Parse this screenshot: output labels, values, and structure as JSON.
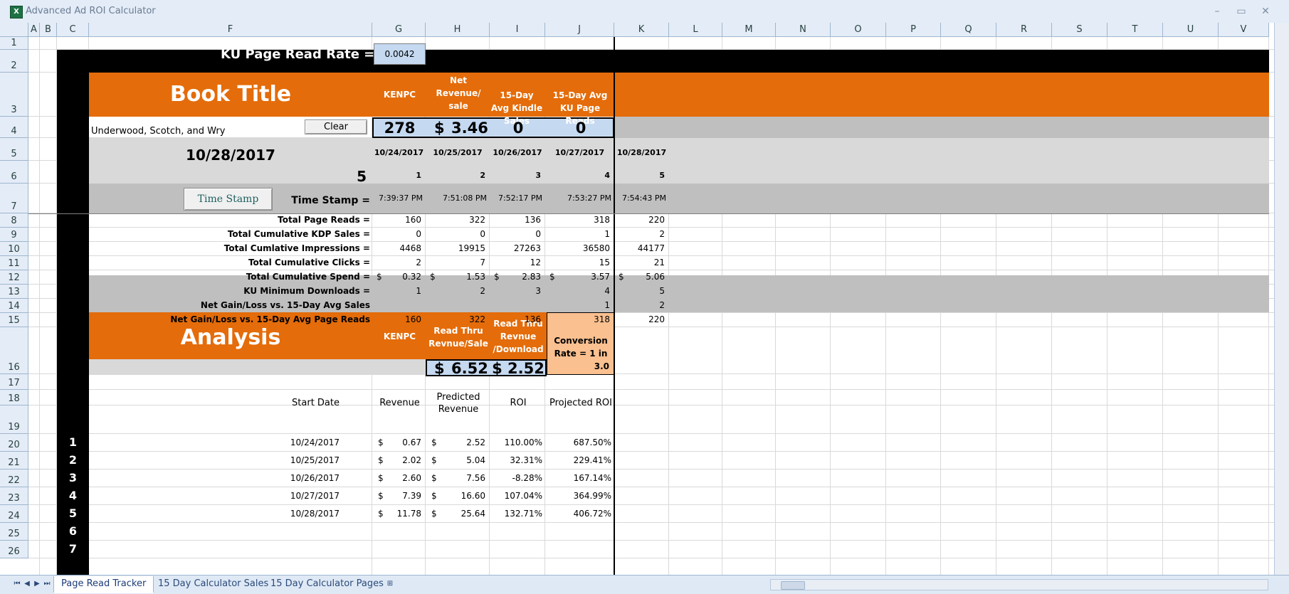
{
  "window": {
    "title": "Advanced Ad ROI Calculator",
    "icon": "excel-icon",
    "minimize": "–",
    "restore": "▭",
    "close": "✕"
  },
  "columns": [
    "A",
    "B",
    "C",
    "F",
    "G",
    "H",
    "I",
    "J",
    "K",
    "L",
    "M",
    "N",
    "O",
    "P",
    "Q",
    "R",
    "S",
    "T",
    "U",
    "V"
  ],
  "rows": [
    "1",
    "2",
    "3",
    "4",
    "5",
    "6",
    "7",
    "8",
    "9",
    "10",
    "11",
    "12",
    "13",
    "14",
    "15",
    "16",
    "17",
    "18",
    "19",
    "20",
    "21",
    "22",
    "23",
    "24",
    "25",
    "26"
  ],
  "ku_rate": {
    "label": "KU Page Read Rate =",
    "value": "0.0042"
  },
  "book_header": {
    "title": "Book Title",
    "kenpc": "KENPC",
    "net_rev": "Net Revenue/ sale",
    "avg_sales": "15-Day Avg Kindle Sales",
    "avg_reads": "15-Day Avg KU Page Reads"
  },
  "book": {
    "name": "Underwood, Scotch, and Wry",
    "clear_label": "Clear",
    "kenpc": "278",
    "net_rev_dollar": "$",
    "net_rev": "3.46",
    "avg_sales": "0",
    "avg_reads": "0"
  },
  "current": {
    "date": "10/28/2017",
    "day": "5"
  },
  "dates": [
    "10/24/2017",
    "10/25/2017",
    "10/26/2017",
    "10/27/2017",
    "10/28/2017"
  ],
  "days": [
    "1",
    "2",
    "3",
    "4",
    "5"
  ],
  "timestamp": {
    "button": "Time Stamp",
    "label": "Time Stamp =",
    "values": [
      "7:39:37 PM",
      "7:51:08 PM",
      "7:52:17 PM",
      "7:53:27 PM",
      "7:54:43 PM"
    ]
  },
  "metrics": [
    {
      "label": "Total Page Reads =",
      "vals": [
        "160",
        "322",
        "136",
        "318",
        "220"
      ]
    },
    {
      "label": "Total Cumulative KDP Sales =",
      "vals": [
        "0",
        "0",
        "0",
        "1",
        "2"
      ]
    },
    {
      "label": "Total Cumlative Impressions =",
      "vals": [
        "4468",
        "19915",
        "27263",
        "36580",
        "44177"
      ]
    },
    {
      "label": "Total Cumulative Clicks =",
      "vals": [
        "2",
        "7",
        "12",
        "15",
        "21"
      ]
    },
    {
      "label": "Total Cumulative Spend =",
      "vals": [
        "0.32",
        "1.53",
        "2.83",
        "3.57",
        "5.06"
      ],
      "currency": "$"
    }
  ],
  "metrics_gray": [
    {
      "label": "KU Minimum Downloads =",
      "vals": [
        "1",
        "2",
        "3",
        "4",
        "5"
      ]
    },
    {
      "label": "Net Gain/Loss vs. 15-Day Avg Sales",
      "vals": [
        "",
        "",
        "",
        "1",
        "2"
      ]
    },
    {
      "label": "Net Gain/Loss vs. 15-Day Avg Page Reads",
      "vals": [
        "160",
        "322",
        "136",
        "318",
        "220"
      ]
    }
  ],
  "analysis": {
    "title": "Analysis",
    "kenpc": "KENPC",
    "rt_sale": "Read Thru Revnue/Sale",
    "rt_dl": "Read Thru Revnue /Download",
    "conv": "Conversion Rate = 1 in",
    "conv_val": "3.0",
    "rt_sale_dollar": "$",
    "rt_sale_val": "6.52",
    "rt_dl_val": "$ 2.52"
  },
  "roi_table": {
    "headers": {
      "start": "Start Date",
      "revenue": "Revenue",
      "predicted": "Predicted Revenue",
      "roi": "ROI",
      "projected": "Projected ROI"
    },
    "currency": "$",
    "rows": [
      {
        "n": "1",
        "date": "10/24/2017",
        "rev": "0.67",
        "pred": "2.52",
        "roi": "110.00%",
        "proj": "687.50%"
      },
      {
        "n": "2",
        "date": "10/25/2017",
        "rev": "2.02",
        "pred": "5.04",
        "roi": "32.31%",
        "proj": "229.41%"
      },
      {
        "n": "3",
        "date": "10/26/2017",
        "rev": "2.60",
        "pred": "7.56",
        "roi": "-8.28%",
        "proj": "167.14%"
      },
      {
        "n": "4",
        "date": "10/27/2017",
        "rev": "7.39",
        "pred": "16.60",
        "roi": "107.04%",
        "proj": "364.99%"
      },
      {
        "n": "5",
        "date": "10/28/2017",
        "rev": "11.78",
        "pred": "25.64",
        "roi": "132.71%",
        "proj": "406.72%"
      }
    ],
    "extra_rows": [
      "6",
      "7"
    ]
  },
  "tabs": [
    "Page Read Tracker",
    "15 Day Calculator Sales",
    "15 Day Calculator Pages"
  ],
  "colors": {
    "orange": "#e46c0a",
    "black": "#000000",
    "gray": "#d9d9d9",
    "blue": "#c5d9f1",
    "peach": "#fac090"
  }
}
